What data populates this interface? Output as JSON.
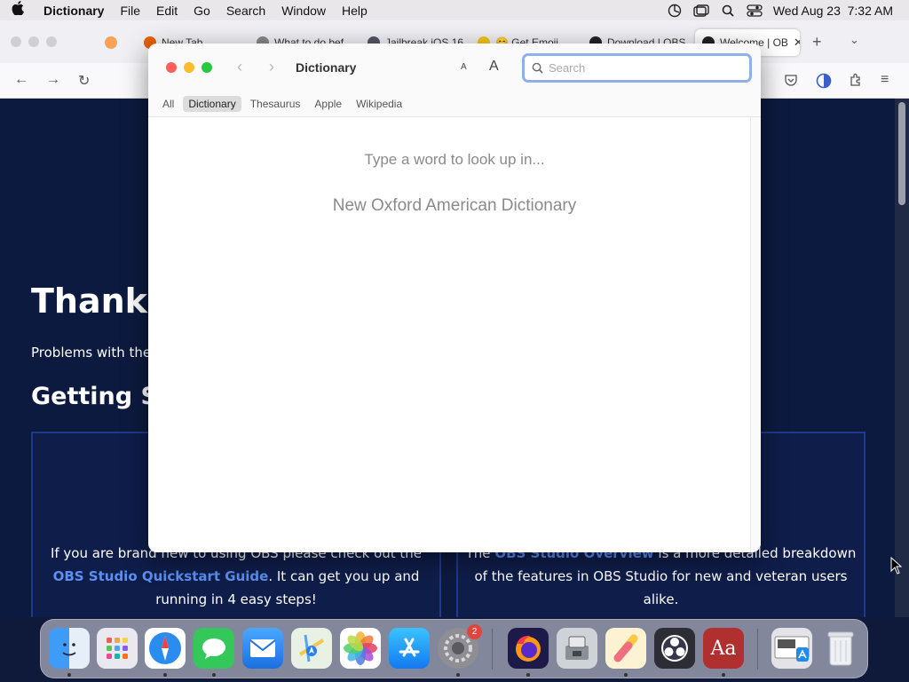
{
  "menubar": {
    "apple": "",
    "app": "Dictionary",
    "items": [
      "File",
      "Edit",
      "Go",
      "Search",
      "Window",
      "Help"
    ],
    "clock": "Wed Aug 23  7:32 AM"
  },
  "browser": {
    "tabs": [
      {
        "label": "New Tab"
      },
      {
        "label": "What to do bef"
      },
      {
        "label": "Jailbreak iOS 16"
      },
      {
        "label": "😊 Get Emoji"
      },
      {
        "label": "Download | OBS"
      },
      {
        "label": "Welcome | OB"
      }
    ],
    "page": {
      "heading": "Thank y",
      "problems": "Problems with the",
      "getting": "Getting St",
      "card1": {
        "pre": "If you are brand new to using OBS please check out the ",
        "link": "OBS Studio Quickstart Guide",
        "post": ". It can get you up and running in 4 easy steps!"
      },
      "card2": {
        "pre": "The ",
        "link": "OBS Studio Overview",
        "post": " is a more detailed breakdown of the features in OBS Studio for new and veteran users alike."
      }
    }
  },
  "dictionary": {
    "title": "Dictionary",
    "font_small": "A",
    "font_big": "A",
    "search_placeholder": "Search",
    "scopes": [
      "All",
      "Dictionary",
      "Thesaurus",
      "Apple",
      "Wikipedia"
    ],
    "selected_scope": "Dictionary",
    "prompt": "Type a word to look up in...",
    "source": "New Oxford American Dictionary"
  },
  "dock": {
    "items": [
      {
        "name": "Finder",
        "icon": "finder-icon"
      },
      {
        "name": "Launchpad",
        "icon": "launchpad-icon"
      },
      {
        "name": "Safari",
        "icon": "safari-icon"
      },
      {
        "name": "Messages",
        "icon": "messages-icon"
      },
      {
        "name": "Mail",
        "icon": "mail-icon"
      },
      {
        "name": "Maps",
        "icon": "maps-icon"
      },
      {
        "name": "Photos",
        "icon": "photos-icon"
      },
      {
        "name": "App Store",
        "icon": "app-store-icon"
      },
      {
        "name": "System Settings",
        "icon": "system-settings-icon",
        "badge": "2"
      },
      {
        "name": "Firefox",
        "icon": "firefox-icon"
      },
      {
        "name": "Boot Camp Assistant",
        "icon": "bootcamp-icon"
      },
      {
        "name": "Highlighter",
        "icon": "highlighter-icon"
      },
      {
        "name": "OBS Studio",
        "icon": "obs-icon"
      },
      {
        "name": "Dictionary",
        "icon": "dictionary-icon",
        "label": "Aa"
      },
      {
        "name": "App Store Download",
        "icon": "downloads-stack-icon"
      },
      {
        "name": "Trash",
        "icon": "trash-icon"
      }
    ]
  },
  "colors": {
    "accent": "#3b82f6",
    "page_bg": "#0d1a3f",
    "link": "#5b8ff0",
    "close": "#ff5f57",
    "minimize": "#febc2e",
    "zoom": "#28c840"
  }
}
